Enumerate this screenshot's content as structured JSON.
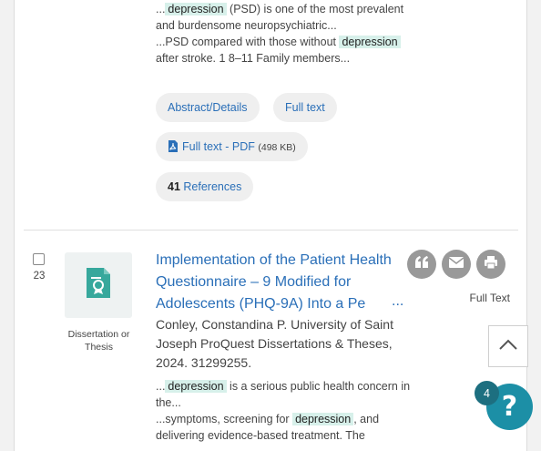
{
  "result_top": {
    "snippet1": {
      "pre": "...",
      "highlight": "depression",
      "post": " (PSD) is one of the most prevalent and burdensome neuropsychiatric..."
    },
    "snippet2": {
      "pre": "...PSD compared with those without ",
      "highlight": "depression",
      "post": " after stroke. 1 8–11 Family members..."
    },
    "actions": {
      "abstract": "Abstract/Details",
      "full_text": "Full text",
      "pdf_label": "Full text - PDF",
      "pdf_size": "(498 KB)",
      "references_count": "41",
      "references_label": "References"
    }
  },
  "result_23": {
    "number": "23",
    "doc_type": "Dissertation or Thesis",
    "title": "Implementation of the Patient Health Questionnaire – 9 Modified for Adolescents (PHQ-9A) Into a Pe",
    "title_ellipsis": "...",
    "meta": "Conley, Constandina P.   University of Saint Joseph ProQuest Dissertations & Theses, 2024. 31299255.",
    "snippet1": {
      "pre": "...",
      "highlight": "depression",
      "post": " is a serious public health concern in the..."
    },
    "snippet2": {
      "pre": "...symptoms, screening for ",
      "highlight": "depression",
      "post": ", and delivering evidence-based treatment. The"
    },
    "full_text_label": "Full Text",
    "icons": [
      "cite-icon",
      "email-icon",
      "print-icon"
    ]
  },
  "floating": {
    "badge_count": "4",
    "help_symbol": "?"
  },
  "colors": {
    "link": "#2a6fb8",
    "highlight": "#d7f0ea",
    "help": "#1c8fa6"
  }
}
